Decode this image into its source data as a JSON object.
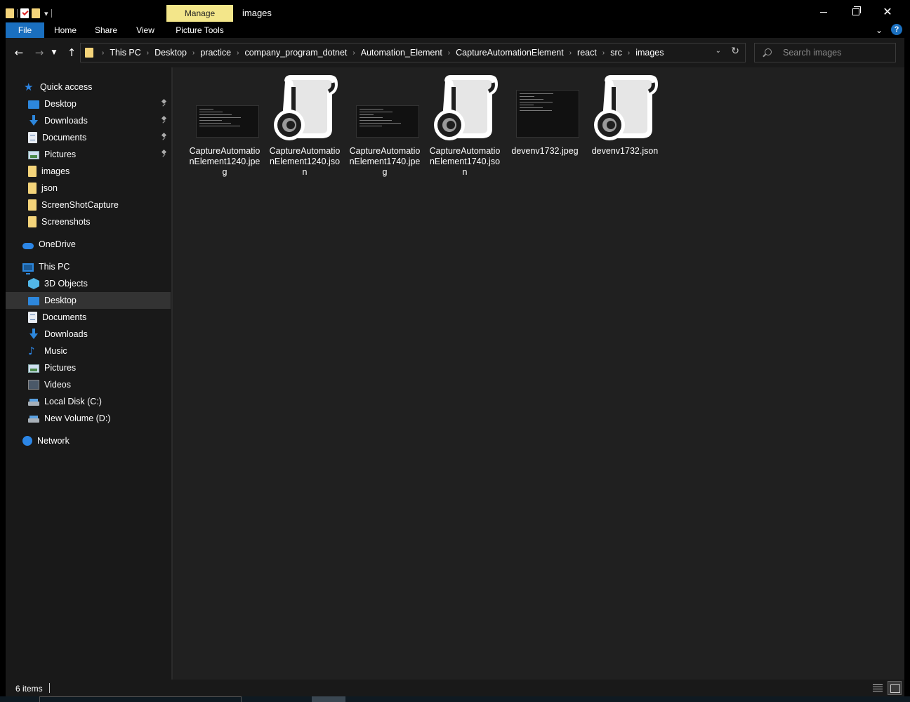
{
  "window": {
    "title": "images",
    "context_tab": "Manage",
    "context_group": "Picture Tools"
  },
  "ribbon": {
    "tabs": [
      "File",
      "Home",
      "Share",
      "View",
      "Picture Tools"
    ],
    "help_label": "?"
  },
  "address": {
    "crumbs": [
      "This PC",
      "Desktop",
      "practice",
      "company_program_dotnet",
      "Automation_Element",
      "CaptureAutomationElement",
      "react",
      "src",
      "images"
    ]
  },
  "search": {
    "placeholder": "Search images"
  },
  "nav": {
    "quick_access": "Quick access",
    "quick_items": [
      {
        "label": "Desktop",
        "icon": "desktop-icon",
        "pinned": true
      },
      {
        "label": "Downloads",
        "icon": "download-icon",
        "pinned": true
      },
      {
        "label": "Documents",
        "icon": "documents-icon",
        "pinned": true
      },
      {
        "label": "Pictures",
        "icon": "pictures-icon",
        "pinned": true
      },
      {
        "label": "images",
        "icon": "folder-icon",
        "pinned": false
      },
      {
        "label": "json",
        "icon": "folder-icon",
        "pinned": false
      },
      {
        "label": "ScreenShotCapture",
        "icon": "folder-icon",
        "pinned": false
      },
      {
        "label": "Screenshots",
        "icon": "folder-icon",
        "pinned": false
      }
    ],
    "onedrive": "OneDrive",
    "this_pc": "This PC",
    "pc_items": [
      {
        "label": "3D Objects",
        "icon": "3d-objects-icon"
      },
      {
        "label": "Desktop",
        "icon": "desktop-icon",
        "selected": true
      },
      {
        "label": "Documents",
        "icon": "documents-icon"
      },
      {
        "label": "Downloads",
        "icon": "download-icon"
      },
      {
        "label": "Music",
        "icon": "music-icon"
      },
      {
        "label": "Pictures",
        "icon": "pictures-icon"
      },
      {
        "label": "Videos",
        "icon": "videos-icon"
      },
      {
        "label": "Local Disk (C:)",
        "icon": "local-disk-icon"
      },
      {
        "label": "New Volume (D:)",
        "icon": "drive-icon"
      }
    ],
    "network": "Network"
  },
  "files": [
    {
      "name": "CaptureAutomationElement1240.jpeg",
      "type": "jpeg"
    },
    {
      "name": "CaptureAutomationElement1240.json",
      "type": "json"
    },
    {
      "name": "CaptureAutomationElement1740.jpeg",
      "type": "jpeg"
    },
    {
      "name": "CaptureAutomationElement1740.json",
      "type": "json"
    },
    {
      "name": "devenv1732.jpeg",
      "type": "jpeg"
    },
    {
      "name": "devenv1732.json",
      "type": "json"
    }
  ],
  "status": {
    "count": "6 items"
  },
  "colors": {
    "accent": "#1a6fbf",
    "manage_tab": "#f3e68a",
    "folder": "#f4d47a",
    "content_bg": "#202020",
    "pane_bg": "#191919"
  }
}
